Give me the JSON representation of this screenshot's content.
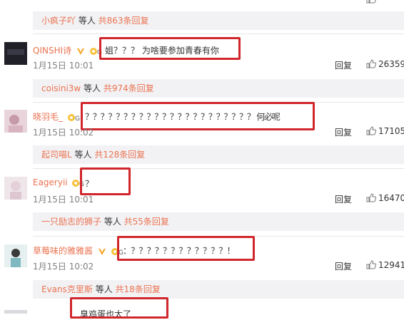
{
  "reply_bars": [
    {
      "user": "小疯子吖",
      "middle": " 等人 ",
      "count": "共863条回复"
    },
    {
      "user": "coisini3w",
      "middle": " 等人 ",
      "count": "共974条回复"
    },
    {
      "user": "起司喵L",
      "middle": " 等人 ",
      "count": "共128条回复"
    },
    {
      "user": "一只励志的狮子",
      "middle": " 等人 ",
      "count": "共55条回复"
    },
    {
      "user": "Evans克里斯",
      "middle": " 等人 ",
      "count": "共18条回复"
    }
  ],
  "comments": [
    {
      "user": "QINSHI诗",
      "text": "姐？？？ 为啥要参加青春有你",
      "date": "1月15日 10:01",
      "reply": "回复",
      "likes": "26359"
    },
    {
      "user": "晓羽毛_",
      "text": "？？？？？？？？？？？？？？？？？？？？？？ 何必呢",
      "date": "1月15日 10:02",
      "reply": "回复",
      "likes": "17105"
    },
    {
      "user": "Eageryii",
      "text": "？",
      "date": "1月15日 10:01",
      "reply": "回复",
      "likes": "16470"
    },
    {
      "user": "草莓味的雅雅酱",
      "text": "：？？？？？？？？？？？？！",
      "date": "1月15日 10:02",
      "reply": "回复",
      "likes": "12941"
    }
  ],
  "partial_comment": {
    "text": "臭鸡蛋也太了"
  },
  "colors": {
    "accent": "#eb7350",
    "highlight": "#d1262b",
    "reply_bg": "#f2f2f5",
    "vip": "#f5a623"
  },
  "icons": {
    "like": "thumbs-up-icon",
    "vip": "verified-v-icon",
    "member": "member-badge-icon"
  }
}
